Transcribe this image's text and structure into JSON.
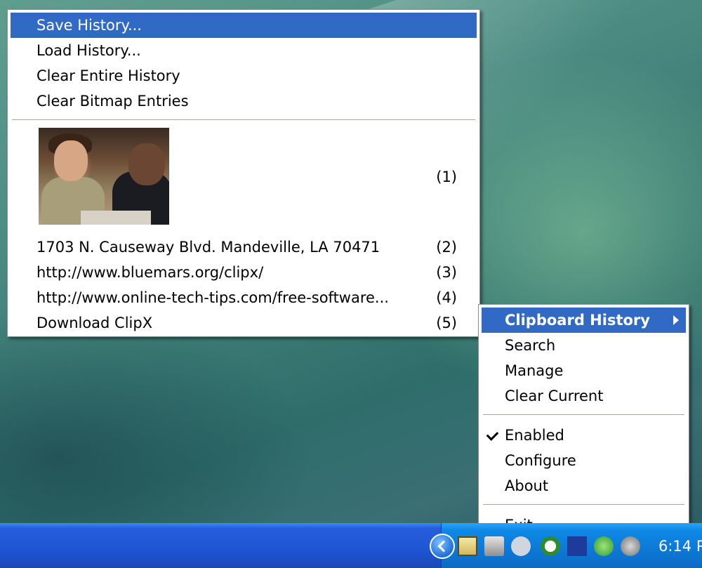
{
  "history_menu": {
    "items": [
      {
        "label": "Save History..."
      },
      {
        "label": "Load History..."
      },
      {
        "label": "Clear Entire History"
      },
      {
        "label": "Clear Bitmap Entries"
      }
    ],
    "entries": [
      {
        "type": "image",
        "num": "(1)"
      },
      {
        "label": "1703 N. Causeway Blvd.  Mandeville, LA 70471",
        "num": "(2)"
      },
      {
        "label": "http://www.bluemars.org/clipx/",
        "num": "(3)"
      },
      {
        "label": "http://www.online-tech-tips.com/free-software...",
        "num": "(4)"
      },
      {
        "label": "Download ClipX",
        "num": "(5)"
      }
    ]
  },
  "tray_menu": {
    "items": [
      {
        "label": "Clipboard History"
      },
      {
        "label": "Search"
      },
      {
        "label": "Manage"
      },
      {
        "label": "Clear Current"
      },
      {
        "label": "Enabled"
      },
      {
        "label": "Configure"
      },
      {
        "label": "About"
      },
      {
        "label": "Exit"
      }
    ]
  },
  "taskbar": {
    "clock": "6:14 P"
  },
  "colors": {
    "highlight": "#316ac5",
    "taskbar": "#245edb",
    "tray": "#0e8ae6"
  }
}
